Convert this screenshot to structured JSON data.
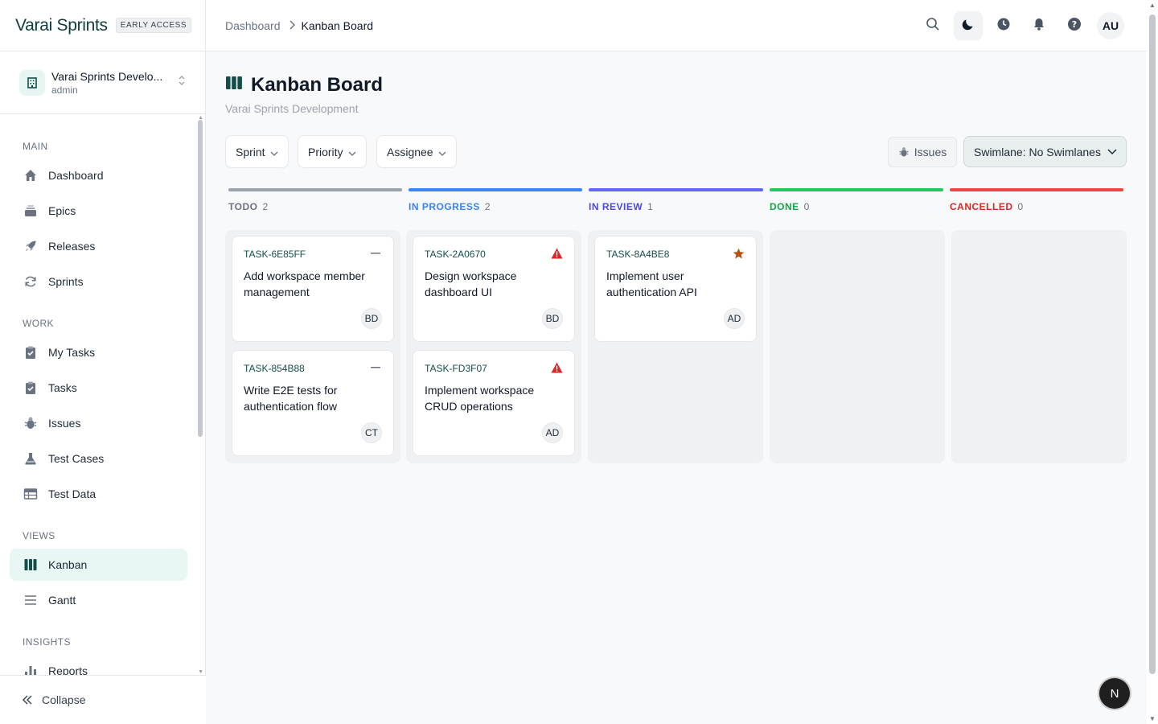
{
  "app": {
    "brand": "Varai Sprints",
    "badge": "EARLY ACCESS"
  },
  "workspace": {
    "name": "Varai Sprints Develo...",
    "role": "admin"
  },
  "sidebar": {
    "sections": [
      {
        "label": "MAIN",
        "items": [
          {
            "label": "Dashboard",
            "icon": "home-icon"
          },
          {
            "label": "Epics",
            "icon": "layers-icon"
          },
          {
            "label": "Releases",
            "icon": "rocket-icon"
          },
          {
            "label": "Sprints",
            "icon": "refresh-icon"
          }
        ]
      },
      {
        "label": "WORK",
        "items": [
          {
            "label": "My Tasks",
            "icon": "clipboard-check-icon"
          },
          {
            "label": "Tasks",
            "icon": "clipboard-check-icon"
          },
          {
            "label": "Issues",
            "icon": "bug-icon"
          },
          {
            "label": "Test Cases",
            "icon": "flask-icon"
          },
          {
            "label": "Test Data",
            "icon": "table-icon"
          }
        ]
      },
      {
        "label": "VIEWS",
        "items": [
          {
            "label": "Kanban",
            "icon": "kanban-icon",
            "active": true
          },
          {
            "label": "Gantt",
            "icon": "bars-icon"
          }
        ]
      },
      {
        "label": "INSIGHTS",
        "items": [
          {
            "label": "Reports",
            "icon": "bar-chart-icon"
          }
        ]
      }
    ],
    "collapse_label": "Collapse"
  },
  "breadcrumb": {
    "parent": "Dashboard",
    "current": "Kanban Board"
  },
  "topbar": {
    "avatar": "AU"
  },
  "page": {
    "title": "Kanban Board",
    "subtitle": "Varai Sprints Development"
  },
  "filters": {
    "sprint": "Sprint",
    "priority": "Priority",
    "assignee": "Assignee",
    "issues": "Issues",
    "swimlane": "Swimlane: No Swimlanes"
  },
  "columns": [
    {
      "title": "TODO",
      "count": "2",
      "color": "#9ca3af",
      "text_color": "#6b7280"
    },
    {
      "title": "IN PROGRESS",
      "count": "2",
      "color": "#3b82f6",
      "text_color": "#3b82f6"
    },
    {
      "title": "IN REVIEW",
      "count": "1",
      "color": "#6366f1",
      "text_color": "#4f46e5"
    },
    {
      "title": "DONE",
      "count": "0",
      "color": "#22c55e",
      "text_color": "#16a34a"
    },
    {
      "title": "CANCELLED",
      "count": "0",
      "color": "#ef4444",
      "text_color": "#dc2626"
    }
  ],
  "cards": {
    "todo": [
      {
        "id": "TASK-6E85FF",
        "title": "Add workspace member management",
        "assignee": "BD",
        "priority_icon": "minus-icon"
      },
      {
        "id": "TASK-854B88",
        "title": "Write E2E tests for authentication flow",
        "assignee": "CT",
        "priority_icon": "minus-icon"
      }
    ],
    "in_progress": [
      {
        "id": "TASK-2A0670",
        "title": "Design workspace dashboard UI",
        "assignee": "BD",
        "priority_icon": "warning-icon"
      },
      {
        "id": "TASK-FD3F07",
        "title": "Implement workspace CRUD operations",
        "assignee": "AD",
        "priority_icon": "warning-icon"
      }
    ],
    "in_review": [
      {
        "id": "TASK-8A4BE8",
        "title": "Implement user authentication API",
        "assignee": "AD",
        "priority_icon": "star-icon"
      }
    ]
  },
  "colors": {
    "accent": "#134e4a",
    "warning": "#dc2626",
    "star": "#b45309"
  },
  "fab": {
    "label": "N"
  }
}
